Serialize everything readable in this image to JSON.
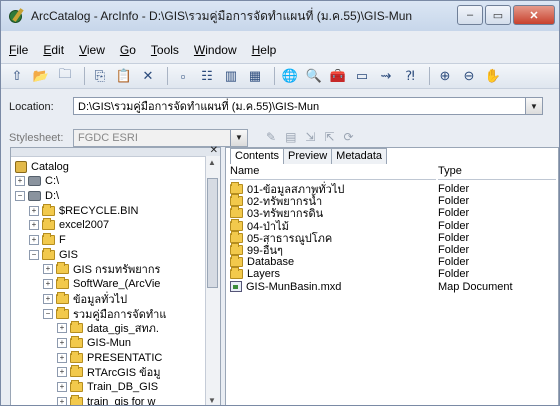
{
  "window": {
    "title": "ArcCatalog - ArcInfo - D:\\GIS\\รวมคู่มือการจัดทำแผนที่ (ม.ค.55)\\GIS-Mun",
    "controls": {
      "minimize": "–",
      "maximize": "▭",
      "close": "✕"
    }
  },
  "menu": [
    {
      "label": "File",
      "accel": "F",
      "rest": "ile"
    },
    {
      "label": "Edit",
      "accel": "E",
      "rest": "dit"
    },
    {
      "label": "View",
      "accel": "V",
      "rest": "iew"
    },
    {
      "label": "Go",
      "accel": "G",
      "rest": "o"
    },
    {
      "label": "Tools",
      "accel": "T",
      "rest": "ools"
    },
    {
      "label": "Window",
      "accel": "W",
      "rest": "indow"
    },
    {
      "label": "Help",
      "accel": "H",
      "rest": "elp"
    }
  ],
  "toolbar": {
    "buttons": [
      {
        "icon": "up-level-icon",
        "glyph": "⇧"
      },
      {
        "icon": "connect-folder-icon",
        "glyph": "📂"
      },
      {
        "icon": "disconnect-folder-icon",
        "glyph": "🗀"
      },
      {
        "icon": "copy-icon",
        "glyph": "⎘"
      },
      {
        "icon": "paste-icon",
        "glyph": "📋"
      },
      {
        "icon": "delete-icon",
        "glyph": "✕"
      },
      {
        "icon": "large-icons-icon",
        "glyph": "▫"
      },
      {
        "icon": "list-icon",
        "glyph": "☷"
      },
      {
        "icon": "details-icon",
        "glyph": "▥"
      },
      {
        "icon": "thumbnails-icon",
        "glyph": "▦"
      },
      {
        "icon": "launch-arcmap-icon",
        "glyph": "🌐"
      },
      {
        "icon": "search-icon",
        "glyph": "🔍"
      },
      {
        "icon": "arctoolbox-icon",
        "glyph": "🧰"
      },
      {
        "icon": "command-line-icon",
        "glyph": "▭"
      },
      {
        "icon": "model-builder-icon",
        "glyph": "⇝"
      },
      {
        "icon": "whats-this-icon",
        "glyph": "⁈"
      },
      {
        "icon": "zoom-in-icon",
        "glyph": "⊕"
      },
      {
        "icon": "zoom-out-icon",
        "glyph": "⊖"
      },
      {
        "icon": "pan-icon",
        "glyph": "✋"
      }
    ]
  },
  "location": {
    "label": "Location:",
    "value": "D:\\GIS\\รวมคู่มือการจัดทำแผนที่ (ม.ค.55)\\GIS-Mun"
  },
  "stylesheet": {
    "label": "Stylesheet:",
    "value": "FGDC ESRI"
  },
  "tree": {
    "items": [
      {
        "label": "Catalog",
        "icon": "catalog-icon",
        "expander": "",
        "level": 0
      },
      {
        "label": "C:\\",
        "icon": "drive-icon",
        "expander": "+",
        "level": 0
      },
      {
        "label": "D:\\",
        "icon": "drive-icon",
        "expander": "−",
        "level": 0
      },
      {
        "label": "$RECYCLE.BIN",
        "icon": "folder-icon",
        "expander": "+",
        "level": 1
      },
      {
        "label": "excel2007",
        "icon": "folder-icon",
        "expander": "+",
        "level": 1
      },
      {
        "label": "F",
        "icon": "folder-icon",
        "expander": "+",
        "level": 1
      },
      {
        "label": "GIS",
        "icon": "folder-icon",
        "expander": "−",
        "level": 1
      },
      {
        "label": "GIS กรมทรัพยากร",
        "icon": "folder-icon",
        "expander": "+",
        "level": 2
      },
      {
        "label": "SoftWare_(ArcVie",
        "icon": "folder-icon",
        "expander": "+",
        "level": 2
      },
      {
        "label": "ข้อมูลทั่วไป",
        "icon": "folder-icon",
        "expander": "+",
        "level": 2
      },
      {
        "label": "รวมคู่มือการจัดทำแ",
        "icon": "folder-icon",
        "expander": "−",
        "level": 2
      },
      {
        "label": "data_gis_สทภ.",
        "icon": "folder-icon",
        "expander": "+",
        "level": 3
      },
      {
        "label": "GIS-Mun",
        "icon": "folder-icon",
        "expander": "+",
        "level": 3
      },
      {
        "label": "PRESENTATIC",
        "icon": "folder-icon",
        "expander": "+",
        "level": 3
      },
      {
        "label": "RTArcGIS ข้อมู",
        "icon": "folder-icon",
        "expander": "+",
        "level": 3
      },
      {
        "label": "Train_DB_GIS",
        "icon": "folder-icon",
        "expander": "+",
        "level": 3
      },
      {
        "label": "train_gis for w",
        "icon": "folder-icon",
        "expander": "+",
        "level": 3
      }
    ]
  },
  "tabs": [
    {
      "label": "Contents",
      "active": true
    },
    {
      "label": "Preview",
      "active": false
    },
    {
      "label": "Metadata",
      "active": false
    }
  ],
  "columns": {
    "name": "Name",
    "type": "Type"
  },
  "files": [
    {
      "name": "01-ข้อมูลสภาพทั่วไป",
      "type": "Folder",
      "icon": "folder-icon"
    },
    {
      "name": "02-ทรัพยากรน้ำ",
      "type": "Folder",
      "icon": "folder-icon"
    },
    {
      "name": "03-ทรัพยากรดิน",
      "type": "Folder",
      "icon": "folder-icon"
    },
    {
      "name": "04-ป่าไม้",
      "type": "Folder",
      "icon": "folder-icon"
    },
    {
      "name": "05-สาธารณูปโภค",
      "type": "Folder",
      "icon": "folder-icon"
    },
    {
      "name": "99-อื่นๆ",
      "type": "Folder",
      "icon": "folder-icon"
    },
    {
      "name": "Database",
      "type": "Folder",
      "icon": "folder-icon"
    },
    {
      "name": "Layers",
      "type": "Folder",
      "icon": "folder-icon"
    },
    {
      "name": "GIS-MunBasin.mxd",
      "type": "Map Document",
      "icon": "map-document-icon"
    }
  ]
}
